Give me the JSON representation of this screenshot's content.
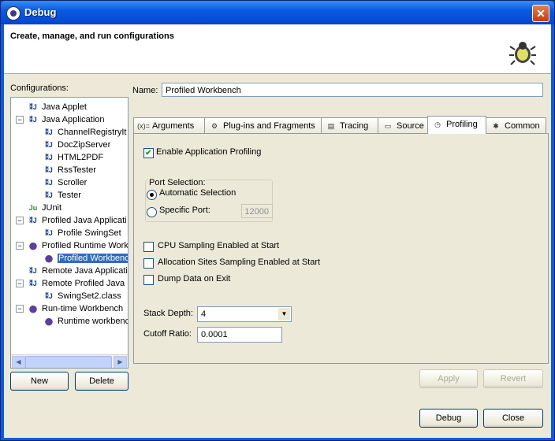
{
  "window": {
    "title": "Debug",
    "close_glyph": "✕"
  },
  "header": {
    "title": "Create, manage, and run configurations",
    "icon": "bug-icon"
  },
  "configurations": {
    "label": "Configurations:",
    "tree": [
      {
        "label": "Java Applet",
        "icon": "java-applet-icon",
        "level": 1,
        "expander": ""
      },
      {
        "label": "Java Application",
        "icon": "java-app-icon",
        "level": 1,
        "expander": "−"
      },
      {
        "label": "ChannelRegistryIt",
        "icon": "java-app-icon",
        "level": 2,
        "expander": ""
      },
      {
        "label": "DocZipServer",
        "icon": "java-app-icon",
        "level": 2,
        "expander": ""
      },
      {
        "label": "HTML2PDF",
        "icon": "java-app-icon",
        "level": 2,
        "expander": ""
      },
      {
        "label": "RssTester",
        "icon": "java-app-icon",
        "level": 2,
        "expander": ""
      },
      {
        "label": "Scroller",
        "icon": "java-app-icon",
        "level": 2,
        "expander": ""
      },
      {
        "label": "Tester",
        "icon": "java-app-icon",
        "level": 2,
        "expander": ""
      },
      {
        "label": "JUnit",
        "icon": "junit-icon",
        "level": 1,
        "expander": ""
      },
      {
        "label": "Profiled Java Applicati",
        "icon": "profiled-java-icon",
        "level": 1,
        "expander": "−"
      },
      {
        "label": "Profile SwingSet",
        "icon": "profiled-java-icon",
        "level": 2,
        "expander": ""
      },
      {
        "label": "Profiled Runtime Work",
        "icon": "runtime-workbench-icon",
        "level": 1,
        "expander": "−"
      },
      {
        "label": "Profiled Workbench",
        "icon": "runtime-workbench-icon",
        "level": 2,
        "expander": "",
        "selected": true
      },
      {
        "label": "Remote Java Applicati",
        "icon": "remote-java-icon",
        "level": 1,
        "expander": ""
      },
      {
        "label": "Remote Profiled Java",
        "icon": "remote-java-icon",
        "level": 1,
        "expander": "−"
      },
      {
        "label": "SwingSet2.class",
        "icon": "remote-java-icon",
        "level": 2,
        "expander": ""
      },
      {
        "label": "Run-time Workbench",
        "icon": "runtime-workbench-icon",
        "level": 1,
        "expander": "−"
      },
      {
        "label": "Runtime workbench",
        "icon": "runtime-workbench-icon",
        "level": 2,
        "expander": ""
      }
    ],
    "new_label": "New",
    "delete_label": "Delete"
  },
  "name": {
    "label": "Name:",
    "value": "Profiled Workbench"
  },
  "tabs": [
    {
      "label": "Arguments",
      "icon": "arguments-icon",
      "glyph": "(x)="
    },
    {
      "label": "Plug-ins and Fragments",
      "icon": "plugins-icon",
      "glyph": "⚙"
    },
    {
      "label": "Tracing",
      "icon": "tracing-icon",
      "glyph": "▤"
    },
    {
      "label": "Source",
      "icon": "source-icon",
      "glyph": "▭"
    },
    {
      "label": "Profiling",
      "icon": "profiling-clock-icon",
      "glyph": "◷",
      "active": true
    },
    {
      "label": "Common",
      "icon": "common-icon",
      "glyph": "✱"
    }
  ],
  "profiling": {
    "enable_label": "Enable Application Profiling",
    "enable_checked": true,
    "port_title": "Port Selection:",
    "auto_label": "Automatic Selection",
    "specific_label": "Specific Port:",
    "port_value": "12000",
    "cpu_label": "CPU Sampling Enabled at Start",
    "alloc_label": "Allocation Sites Sampling Enabled at Start",
    "dump_label": "Dump Data on Exit",
    "stack_label": "Stack Depth:",
    "stack_value": "4",
    "cutoff_label": "Cutoff Ratio:",
    "cutoff_value": "0.0001"
  },
  "buttons": {
    "apply": "Apply",
    "revert": "Revert",
    "debug": "Debug",
    "close": "Close"
  },
  "colors": {
    "title_bar": "#0a5be0",
    "selection": "#316ac5",
    "dialog_bg": "#ece9d8"
  }
}
